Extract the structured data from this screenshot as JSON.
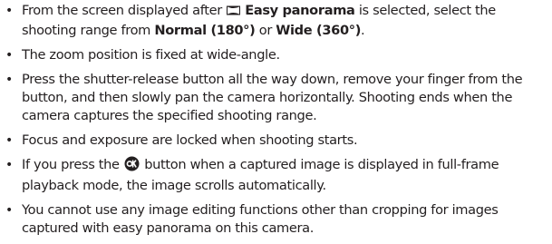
{
  "items": [
    {
      "pre": "From the screen displayed after ",
      "icon": "easy-panorama-icon",
      "mode_name": "Easy panorama",
      "mid": " is selected, select the shooting range from ",
      "option1": "Normal (180°)",
      "or": " or ",
      "option2": "Wide (360°)",
      "end": "."
    },
    {
      "text": "The zoom position is fixed at wide-angle."
    },
    {
      "text": "Press the shutter-release button all the way down, remove your finger from the button, and then slowly pan the camera horizontally. Shooting ends when the camera captures the specified shooting range."
    },
    {
      "text": "Focus and exposure are locked when shooting starts."
    },
    {
      "pre": "If you press the ",
      "icon": "ok-button-icon",
      "post": " button when a captured image is displayed in full-frame playback mode, the image scrolls automatically."
    },
    {
      "text": "You cannot use any image editing functions other than cropping for images captured with easy panorama on this camera."
    }
  ],
  "bullet_char": "•"
}
